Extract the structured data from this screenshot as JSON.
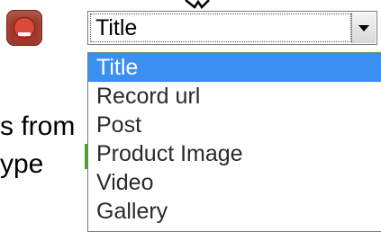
{
  "select": {
    "value": "Title",
    "options": [
      "Title",
      "Record url",
      "Post",
      "Product Image",
      "Video",
      "Gallery"
    ],
    "selected_index": 0
  },
  "background_text": {
    "line1": "s from",
    "line2": "ype"
  },
  "icons": {
    "remove": "minus-circle-icon",
    "arrow": "chevron-down-icon",
    "cursor": "pointer-cursor"
  },
  "colors": {
    "remove_button": "#9e3a2c",
    "selected_option": "#3a8ff0",
    "selected_text": "#ffffff"
  }
}
